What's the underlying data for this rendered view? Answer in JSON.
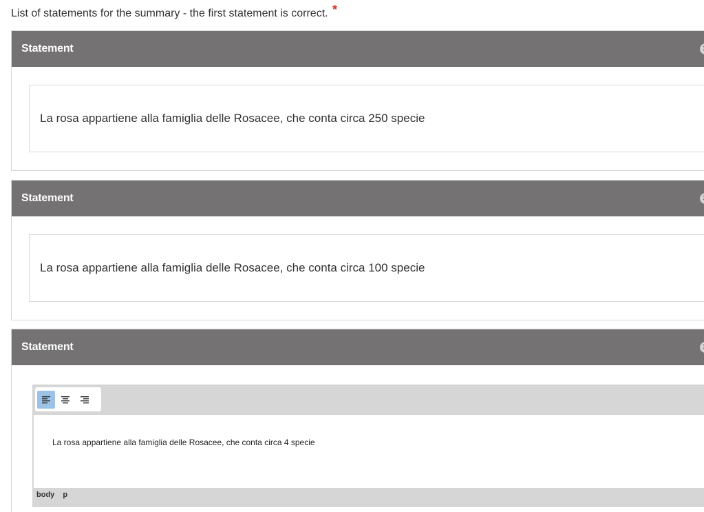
{
  "list_label": "List of statements for the summary - the first statement is correct.",
  "required_marker": "*",
  "statements": [
    {
      "header": "Statement",
      "text": "La rosa appartiene alla famiglia delle Rosacee, che conta circa 250 specie",
      "remove_icon": "close-circle-icon"
    },
    {
      "header": "Statement",
      "text": "La rosa appartiene alla famiglia delle Rosacee, che conta circa 100 specie",
      "remove_icon": "close-circle-icon"
    },
    {
      "header": "Statement",
      "text": "La rosa appartiene alla famiglia delle Rosacee, che conta circa 4 specie",
      "remove_icon": "close-circle-icon",
      "editor": {
        "toolbar": {
          "buttons": [
            {
              "name": "align-left-icon",
              "active": true
            },
            {
              "name": "align-center-icon",
              "active": false
            },
            {
              "name": "align-right-icon",
              "active": false
            }
          ]
        },
        "path": [
          "body",
          "p"
        ]
      }
    }
  ],
  "colors": {
    "header_bg": "#747273",
    "required": "#d9342b",
    "active_button": "#9cc3e6",
    "editor_frame": "#d6d6d6"
  }
}
